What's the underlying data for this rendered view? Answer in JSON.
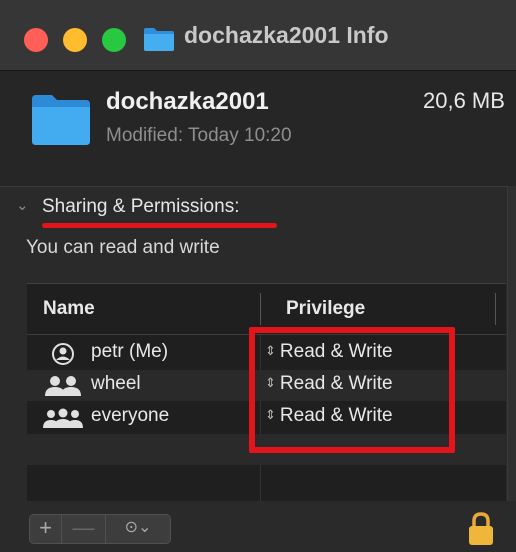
{
  "window": {
    "title": "dochazka2001 Info"
  },
  "file": {
    "name": "dochazka2001",
    "size": "20,6 MB",
    "modified": "Modified: Today 10:20"
  },
  "sharing": {
    "section_title": "Sharing & Permissions:",
    "note": "You can read and write",
    "columns": {
      "name": "Name",
      "privilege": "Privilege"
    },
    "rows": [
      {
        "user": "petr (Me)",
        "privilege": "Read & Write",
        "icon": "single-user-icon"
      },
      {
        "user": "wheel",
        "privilege": "Read & Write",
        "icon": "group-icon"
      },
      {
        "user": "everyone",
        "privilege": "Read & Write",
        "icon": "everyone-icon"
      }
    ]
  },
  "toolbar": {
    "add_label": "+",
    "remove_label": "—",
    "more_label": "⊙⌄"
  },
  "colors": {
    "accent_red": "#e4141b",
    "folder_blue": "#3aa0ea"
  }
}
